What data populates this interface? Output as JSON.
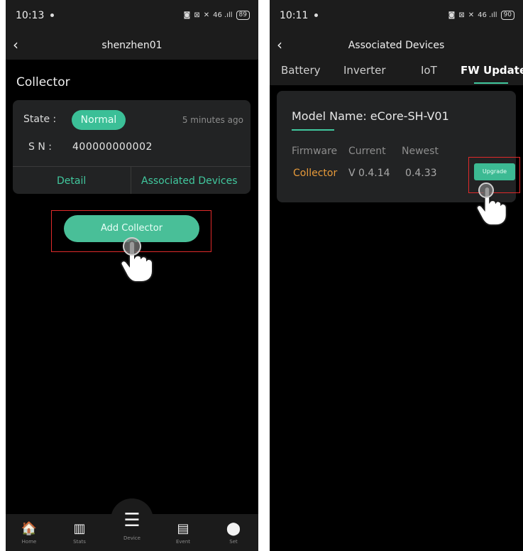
{
  "left_screen": {
    "status_bar": {
      "time": "10:13",
      "signal": "46 .ıll",
      "battery": "89"
    },
    "app_bar": {
      "back_glyph": "‹",
      "title": "shenzhen01"
    },
    "section_title": "Collector",
    "collector_card": {
      "state_label": "State :",
      "state_value": "Normal",
      "updated": "5 minutes ago",
      "sn_label": "S N :",
      "sn_value": "400000000002",
      "detail_label": "Detail",
      "associated_label": "Associated Devices"
    },
    "add_button_label": "Add Collector",
    "nav": [
      {
        "label": "Home",
        "icon": "home-icon",
        "glyph": "🏠"
      },
      {
        "label": "Stats",
        "icon": "stats-icon",
        "glyph": "▥"
      },
      {
        "label": "Device",
        "icon": "device-icon",
        "glyph": "☰"
      },
      {
        "label": "Event",
        "icon": "event-icon",
        "glyph": "▤"
      },
      {
        "label": "Set",
        "icon": "set-icon",
        "glyph": "⬤"
      }
    ]
  },
  "right_screen": {
    "status_bar": {
      "time": "10:11",
      "signal": "46 .ıll",
      "battery": "90"
    },
    "app_bar": {
      "back_glyph": "‹",
      "title": "Associated Devices"
    },
    "tabs": [
      "Battery",
      "Inverter",
      "IoT",
      "FW Updates"
    ],
    "active_tab": "FW Updates",
    "fw_card": {
      "model_label": "Model Name: eCore-SH-V01",
      "headers": [
        "Firmware",
        "Current",
        "Newest"
      ],
      "row": {
        "firmware": "Collector",
        "current": "V 0.4.14",
        "newest": "0.4.33"
      },
      "upgrade_label": "Upgrade"
    }
  },
  "colors": {
    "accent": "#41c89e",
    "highlight": "#e02a2a",
    "firmware_name": "#e79a3a",
    "card_bg": "#222324",
    "bar_bg": "#1c1c1c"
  }
}
